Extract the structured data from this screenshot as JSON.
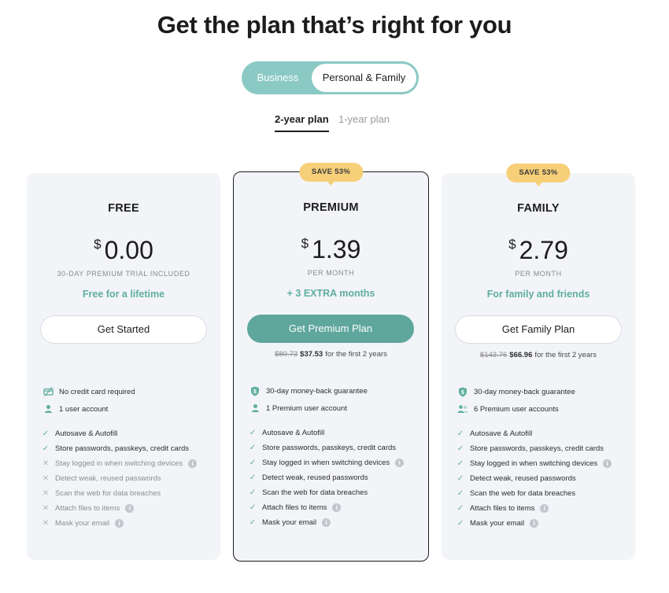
{
  "page": {
    "title": "Get the plan that’s right for you"
  },
  "segment_toggle": {
    "business": "Business",
    "personal": "Personal & Family"
  },
  "billing_tabs": {
    "two_year": "2-year plan",
    "one_year": "1-year plan"
  },
  "colors": {
    "accent": "#5fa69d",
    "accent_light": "#8bc9c4",
    "badge": "#f7cf79",
    "card_bg": "#f2f4f8"
  },
  "plans": {
    "free": {
      "name": "FREE",
      "currency": "$",
      "price": "0.00",
      "subtitle": "30-DAY PREMIUM TRIAL INCLUDED",
      "tagline": "Free for a lifetime",
      "cta": "Get Started",
      "meta": [
        {
          "icon": "no-card-icon",
          "text": "No credit card required"
        },
        {
          "icon": "user-icon",
          "text": "1 user account"
        }
      ],
      "features": [
        {
          "text": "Autosave & Autofill",
          "included": true
        },
        {
          "text": "Store passwords, passkeys, credit cards",
          "included": true
        },
        {
          "text": "Stay logged in when switching devices",
          "included": false,
          "info": true
        },
        {
          "text": "Detect weak, reused passwords",
          "included": false
        },
        {
          "text": "Scan the web for data breaches",
          "included": false
        },
        {
          "text": "Attach files to items",
          "included": false,
          "info": true
        },
        {
          "text": "Mask your email",
          "included": false,
          "info": true
        }
      ]
    },
    "premium": {
      "badge": "SAVE 53%",
      "name": "PREMIUM",
      "currency": "$",
      "price": "1.39",
      "subtitle": "PER MONTH",
      "tagline": "+ 3 EXTRA months",
      "cta": "Get Premium Plan",
      "promo": {
        "old": "$80.73",
        "new": "$37.53",
        "suffix": "for the first 2 years"
      },
      "meta": [
        {
          "icon": "shield-dollar-icon",
          "text": "30-day money-back guarantee"
        },
        {
          "icon": "user-icon",
          "text": "1 Premium user account"
        }
      ],
      "features": [
        {
          "text": "Autosave & Autofill",
          "included": true
        },
        {
          "text": "Store passwords, passkeys, credit cards",
          "included": true
        },
        {
          "text": "Stay logged in when switching devices",
          "included": true,
          "info": true
        },
        {
          "text": "Detect weak, reused passwords",
          "included": true
        },
        {
          "text": "Scan the web for data breaches",
          "included": true
        },
        {
          "text": "Attach files to items",
          "included": true,
          "info": true
        },
        {
          "text": "Mask your email",
          "included": true,
          "info": true
        }
      ]
    },
    "family": {
      "badge": "SAVE 53%",
      "name": "FAMILY",
      "currency": "$",
      "price": "2.79",
      "subtitle": "PER MONTH",
      "tagline": "For family and friends",
      "cta": "Get Family Plan",
      "promo": {
        "old": "$143.76",
        "new": "$66.96",
        "suffix": "for the first 2 years"
      },
      "meta": [
        {
          "icon": "shield-dollar-icon",
          "text": "30-day money-back guarantee"
        },
        {
          "icon": "users-icon",
          "text": "6 Premium user accounts"
        }
      ],
      "features": [
        {
          "text": "Autosave & Autofill",
          "included": true
        },
        {
          "text": "Store passwords, passkeys, credit cards",
          "included": true
        },
        {
          "text": "Stay logged in when switching devices",
          "included": true,
          "info": true
        },
        {
          "text": "Detect weak, reused passwords",
          "included": true
        },
        {
          "text": "Scan the web for data breaches",
          "included": true
        },
        {
          "text": "Attach files to items",
          "included": true,
          "info": true
        },
        {
          "text": "Mask your email",
          "included": true,
          "info": true
        }
      ]
    }
  }
}
